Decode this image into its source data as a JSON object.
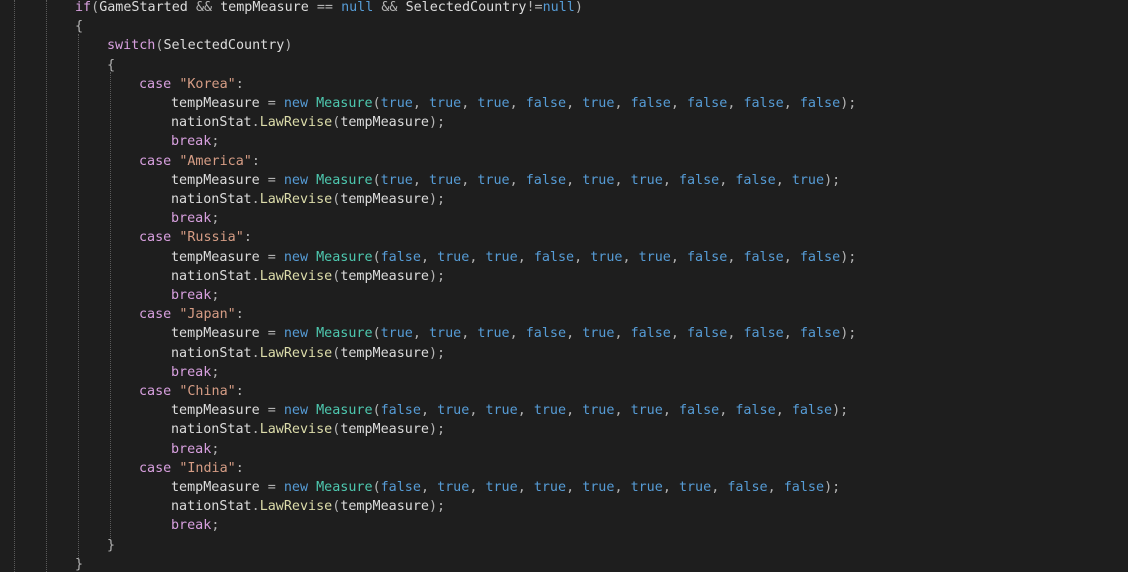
{
  "editor": {
    "theme": {
      "background": "#1e1e1e",
      "keyword": "#569cd6",
      "control": "#d8a0df",
      "string": "#d69d85",
      "type": "#4ec9b0",
      "method": "#dcdcaa",
      "text": "#dcdcdc"
    },
    "lines": [
      {
        "indent": 2,
        "tokens": [
          [
            "ctl",
            "if"
          ],
          [
            "op",
            "("
          ],
          [
            "id",
            "GameStarted "
          ],
          [
            "op",
            "&& "
          ],
          [
            "id",
            "tempMeasure "
          ],
          [
            "op",
            "== "
          ],
          [
            "kw",
            "null "
          ],
          [
            "op",
            "&& "
          ],
          [
            "id",
            "SelectedCountry"
          ],
          [
            "op",
            "!="
          ],
          [
            "kw",
            "null"
          ],
          [
            "op",
            ")"
          ]
        ]
      },
      {
        "indent": 2,
        "tokens": [
          [
            "op",
            "{"
          ]
        ]
      },
      {
        "indent": 3,
        "tokens": [
          [
            "ctl",
            "switch"
          ],
          [
            "op",
            "("
          ],
          [
            "id",
            "SelectedCountry"
          ],
          [
            "op",
            ")"
          ]
        ]
      },
      {
        "indent": 3,
        "tokens": [
          [
            "op",
            "{"
          ]
        ]
      },
      {
        "indent": 4,
        "tokens": [
          [
            "ctl",
            "case "
          ],
          [
            "str",
            "\"Korea\""
          ],
          [
            "op",
            ":"
          ]
        ]
      },
      {
        "indent": 5,
        "tokens": [
          [
            "id",
            "tempMeasure "
          ],
          [
            "op",
            "= "
          ],
          [
            "kw",
            "new "
          ],
          [
            "type",
            "Measure"
          ],
          [
            "op",
            "("
          ],
          [
            "kw",
            "true"
          ],
          [
            "op",
            ", "
          ],
          [
            "kw",
            "true"
          ],
          [
            "op",
            ", "
          ],
          [
            "kw",
            "true"
          ],
          [
            "op",
            ", "
          ],
          [
            "kw",
            "false"
          ],
          [
            "op",
            ", "
          ],
          [
            "kw",
            "true"
          ],
          [
            "op",
            ", "
          ],
          [
            "kw",
            "false"
          ],
          [
            "op",
            ", "
          ],
          [
            "kw",
            "false"
          ],
          [
            "op",
            ", "
          ],
          [
            "kw",
            "false"
          ],
          [
            "op",
            ", "
          ],
          [
            "kw",
            "false"
          ],
          [
            "op",
            ");"
          ]
        ]
      },
      {
        "indent": 5,
        "tokens": [
          [
            "id",
            "nationStat"
          ],
          [
            "op",
            "."
          ],
          [
            "fn",
            "LawRevise"
          ],
          [
            "op",
            "("
          ],
          [
            "id",
            "tempMeasure"
          ],
          [
            "op",
            ");"
          ]
        ]
      },
      {
        "indent": 5,
        "tokens": [
          [
            "ctl",
            "break"
          ],
          [
            "op",
            ";"
          ]
        ]
      },
      {
        "indent": 4,
        "tokens": [
          [
            "ctl",
            "case "
          ],
          [
            "str",
            "\"America\""
          ],
          [
            "op",
            ":"
          ]
        ]
      },
      {
        "indent": 5,
        "tokens": [
          [
            "id",
            "tempMeasure "
          ],
          [
            "op",
            "= "
          ],
          [
            "kw",
            "new "
          ],
          [
            "type",
            "Measure"
          ],
          [
            "op",
            "("
          ],
          [
            "kw",
            "true"
          ],
          [
            "op",
            ", "
          ],
          [
            "kw",
            "true"
          ],
          [
            "op",
            ", "
          ],
          [
            "kw",
            "true"
          ],
          [
            "op",
            ", "
          ],
          [
            "kw",
            "false"
          ],
          [
            "op",
            ", "
          ],
          [
            "kw",
            "true"
          ],
          [
            "op",
            ", "
          ],
          [
            "kw",
            "true"
          ],
          [
            "op",
            ", "
          ],
          [
            "kw",
            "false"
          ],
          [
            "op",
            ", "
          ],
          [
            "kw",
            "false"
          ],
          [
            "op",
            ", "
          ],
          [
            "kw",
            "true"
          ],
          [
            "op",
            ");"
          ]
        ]
      },
      {
        "indent": 5,
        "tokens": [
          [
            "id",
            "nationStat"
          ],
          [
            "op",
            "."
          ],
          [
            "fn",
            "LawRevise"
          ],
          [
            "op",
            "("
          ],
          [
            "id",
            "tempMeasure"
          ],
          [
            "op",
            ");"
          ]
        ]
      },
      {
        "indent": 5,
        "tokens": [
          [
            "ctl",
            "break"
          ],
          [
            "op",
            ";"
          ]
        ]
      },
      {
        "indent": 4,
        "tokens": [
          [
            "ctl",
            "case "
          ],
          [
            "str",
            "\"Russia\""
          ],
          [
            "op",
            ":"
          ]
        ]
      },
      {
        "indent": 5,
        "tokens": [
          [
            "id",
            "tempMeasure "
          ],
          [
            "op",
            "= "
          ],
          [
            "kw",
            "new "
          ],
          [
            "type",
            "Measure"
          ],
          [
            "op",
            "("
          ],
          [
            "kw",
            "false"
          ],
          [
            "op",
            ", "
          ],
          [
            "kw",
            "true"
          ],
          [
            "op",
            ", "
          ],
          [
            "kw",
            "true"
          ],
          [
            "op",
            ", "
          ],
          [
            "kw",
            "false"
          ],
          [
            "op",
            ", "
          ],
          [
            "kw",
            "true"
          ],
          [
            "op",
            ", "
          ],
          [
            "kw",
            "true"
          ],
          [
            "op",
            ", "
          ],
          [
            "kw",
            "false"
          ],
          [
            "op",
            ", "
          ],
          [
            "kw",
            "false"
          ],
          [
            "op",
            ", "
          ],
          [
            "kw",
            "false"
          ],
          [
            "op",
            ");"
          ]
        ]
      },
      {
        "indent": 5,
        "tokens": [
          [
            "id",
            "nationStat"
          ],
          [
            "op",
            "."
          ],
          [
            "fn",
            "LawRevise"
          ],
          [
            "op",
            "("
          ],
          [
            "id",
            "tempMeasure"
          ],
          [
            "op",
            ");"
          ]
        ]
      },
      {
        "indent": 5,
        "tokens": [
          [
            "ctl",
            "break"
          ],
          [
            "op",
            ";"
          ]
        ]
      },
      {
        "indent": 4,
        "tokens": [
          [
            "ctl",
            "case "
          ],
          [
            "str",
            "\"Japan\""
          ],
          [
            "op",
            ":"
          ]
        ]
      },
      {
        "indent": 5,
        "tokens": [
          [
            "id",
            "tempMeasure "
          ],
          [
            "op",
            "= "
          ],
          [
            "kw",
            "new "
          ],
          [
            "type",
            "Measure"
          ],
          [
            "op",
            "("
          ],
          [
            "kw",
            "true"
          ],
          [
            "op",
            ", "
          ],
          [
            "kw",
            "true"
          ],
          [
            "op",
            ", "
          ],
          [
            "kw",
            "true"
          ],
          [
            "op",
            ", "
          ],
          [
            "kw",
            "false"
          ],
          [
            "op",
            ", "
          ],
          [
            "kw",
            "true"
          ],
          [
            "op",
            ", "
          ],
          [
            "kw",
            "false"
          ],
          [
            "op",
            ", "
          ],
          [
            "kw",
            "false"
          ],
          [
            "op",
            ", "
          ],
          [
            "kw",
            "false"
          ],
          [
            "op",
            ", "
          ],
          [
            "kw",
            "false"
          ],
          [
            "op",
            ");"
          ]
        ]
      },
      {
        "indent": 5,
        "tokens": [
          [
            "id",
            "nationStat"
          ],
          [
            "op",
            "."
          ],
          [
            "fn",
            "LawRevise"
          ],
          [
            "op",
            "("
          ],
          [
            "id",
            "tempMeasure"
          ],
          [
            "op",
            ");"
          ]
        ]
      },
      {
        "indent": 5,
        "tokens": [
          [
            "ctl",
            "break"
          ],
          [
            "op",
            ";"
          ]
        ]
      },
      {
        "indent": 4,
        "tokens": [
          [
            "ctl",
            "case "
          ],
          [
            "str",
            "\"China\""
          ],
          [
            "op",
            ":"
          ]
        ]
      },
      {
        "indent": 5,
        "tokens": [
          [
            "id",
            "tempMeasure "
          ],
          [
            "op",
            "= "
          ],
          [
            "kw",
            "new "
          ],
          [
            "type",
            "Measure"
          ],
          [
            "op",
            "("
          ],
          [
            "kw",
            "false"
          ],
          [
            "op",
            ", "
          ],
          [
            "kw",
            "true"
          ],
          [
            "op",
            ", "
          ],
          [
            "kw",
            "true"
          ],
          [
            "op",
            ", "
          ],
          [
            "kw",
            "true"
          ],
          [
            "op",
            ", "
          ],
          [
            "kw",
            "true"
          ],
          [
            "op",
            ", "
          ],
          [
            "kw",
            "true"
          ],
          [
            "op",
            ", "
          ],
          [
            "kw",
            "false"
          ],
          [
            "op",
            ", "
          ],
          [
            "kw",
            "false"
          ],
          [
            "op",
            ", "
          ],
          [
            "kw",
            "false"
          ],
          [
            "op",
            ");"
          ]
        ]
      },
      {
        "indent": 5,
        "tokens": [
          [
            "id",
            "nationStat"
          ],
          [
            "op",
            "."
          ],
          [
            "fn",
            "LawRevise"
          ],
          [
            "op",
            "("
          ],
          [
            "id",
            "tempMeasure"
          ],
          [
            "op",
            ");"
          ]
        ]
      },
      {
        "indent": 5,
        "tokens": [
          [
            "ctl",
            "break"
          ],
          [
            "op",
            ";"
          ]
        ]
      },
      {
        "indent": 4,
        "tokens": [
          [
            "ctl",
            "case "
          ],
          [
            "str",
            "\"India\""
          ],
          [
            "op",
            ":"
          ]
        ]
      },
      {
        "indent": 5,
        "tokens": [
          [
            "id",
            "tempMeasure "
          ],
          [
            "op",
            "= "
          ],
          [
            "kw",
            "new "
          ],
          [
            "type",
            "Measure"
          ],
          [
            "op",
            "("
          ],
          [
            "kw",
            "false"
          ],
          [
            "op",
            ", "
          ],
          [
            "kw",
            "true"
          ],
          [
            "op",
            ", "
          ],
          [
            "kw",
            "true"
          ],
          [
            "op",
            ", "
          ],
          [
            "kw",
            "true"
          ],
          [
            "op",
            ", "
          ],
          [
            "kw",
            "true"
          ],
          [
            "op",
            ", "
          ],
          [
            "kw",
            "true"
          ],
          [
            "op",
            ", "
          ],
          [
            "kw",
            "true"
          ],
          [
            "op",
            ", "
          ],
          [
            "kw",
            "false"
          ],
          [
            "op",
            ", "
          ],
          [
            "kw",
            "false"
          ],
          [
            "op",
            ");"
          ]
        ]
      },
      {
        "indent": 5,
        "tokens": [
          [
            "id",
            "nationStat"
          ],
          [
            "op",
            "."
          ],
          [
            "fn",
            "LawRevise"
          ],
          [
            "op",
            "("
          ],
          [
            "id",
            "tempMeasure"
          ],
          [
            "op",
            ");"
          ]
        ]
      },
      {
        "indent": 5,
        "tokens": [
          [
            "ctl",
            "break"
          ],
          [
            "op",
            ";"
          ]
        ]
      },
      {
        "indent": 3,
        "tokens": [
          [
            "op",
            "}"
          ]
        ]
      },
      {
        "indent": 2,
        "tokens": [
          [
            "op",
            "}"
          ]
        ]
      }
    ]
  }
}
